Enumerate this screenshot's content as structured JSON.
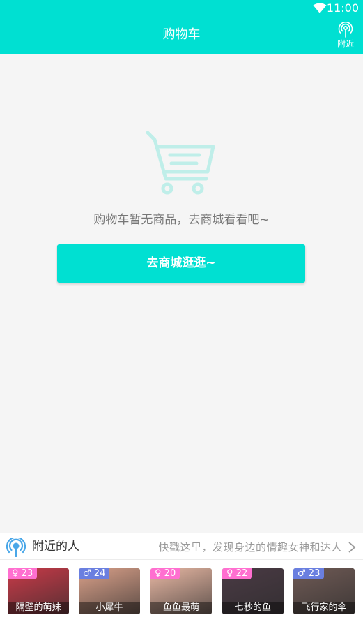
{
  "status_bar": {
    "time": "11:00"
  },
  "app_bar": {
    "title": "购物车",
    "nearby_label": "附近"
  },
  "empty_state": {
    "message": "购物车暂无商品，去商城看看吧~",
    "button_label": "去商城逛逛~"
  },
  "nearby_panel": {
    "title": "附近的人",
    "hint": "快戳这里，发现身边的情趣女神和达人",
    "users": [
      {
        "gender": "female",
        "gender_symbol": "♀",
        "age": "23",
        "name": "隔壁的萌妹",
        "photo_color": "#c83a48"
      },
      {
        "gender": "male",
        "gender_symbol": "♂",
        "age": "24",
        "name": "小犀牛",
        "photo_color": "#d9a089"
      },
      {
        "gender": "female",
        "gender_symbol": "♀",
        "age": "20",
        "name": "鱼鱼最萌",
        "photo_color": "#e7b7a3"
      },
      {
        "gender": "female",
        "gender_symbol": "♀",
        "age": "22",
        "name": "七秒的鱼",
        "photo_color": "#4a3a44"
      },
      {
        "gender": "male",
        "gender_symbol": "♂",
        "age": "23",
        "name": "飞行家的伞",
        "photo_color": "#6f5a55"
      }
    ]
  },
  "colors": {
    "accent": "#00e0d2",
    "female_badge": "#ff6fd0",
    "male_badge": "#6a7fe0"
  }
}
